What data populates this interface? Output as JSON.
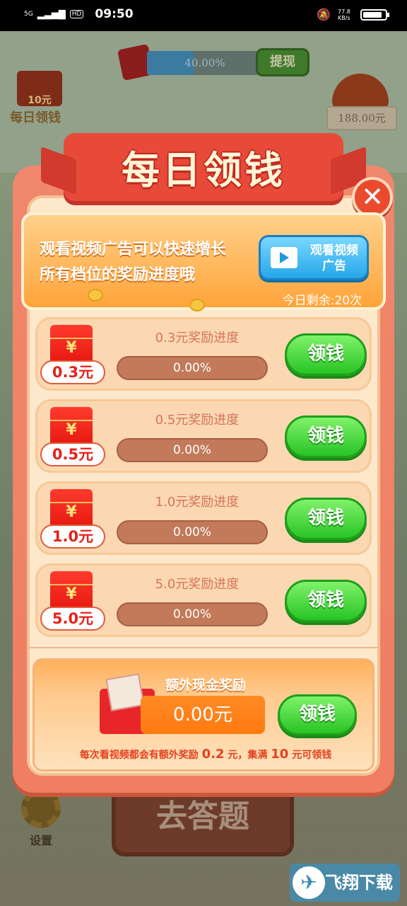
{
  "status_bar": {
    "network": "5G",
    "hd": "HD",
    "time": "09:50",
    "speed": "77.8 KB/s"
  },
  "background": {
    "progress_text": "40.00%",
    "progress_fraction": 0.4,
    "withdraw_label": "提现",
    "daily_icon_amount": "10元",
    "daily_icon_label": "每日领钱",
    "balance": "188.00元",
    "settings_label": "设置",
    "quiz_button": "去答题",
    "watermark_text": "飞翔下载"
  },
  "modal": {
    "title": "每日领钱",
    "close_symbol": "✕",
    "ad": {
      "line1": "观看视频广告可以快速增长",
      "line2": "所有档位的奖励进度哦",
      "watch_button": "观看视频广告",
      "remaining": "今日剩余:20次"
    },
    "tiers": [
      {
        "amount": "0.3元",
        "title": "0.3元奖励进度",
        "progress_text": "0.00%",
        "progress": 0,
        "button": "领钱",
        "yen": "¥"
      },
      {
        "amount": "0.5元",
        "title": "0.5元奖励进度",
        "progress_text": "0.00%",
        "progress": 0,
        "button": "领钱",
        "yen": "¥"
      },
      {
        "amount": "1.0元",
        "title": "1.0元奖励进度",
        "progress_text": "0.00%",
        "progress": 0,
        "button": "领钱",
        "yen": "¥"
      },
      {
        "amount": "5.0元",
        "title": "5.0元奖励进度",
        "progress_text": "0.00%",
        "progress": 0,
        "button": "领钱",
        "yen": "¥"
      }
    ],
    "bonus": {
      "title": "额外现金奖励",
      "amount": "0.00元",
      "button": "领钱",
      "note_prefix": "每次看视频都会有额外奖励",
      "note_value1": "0.2",
      "note_mid": "元，集满",
      "note_value2": "10",
      "note_suffix": "元可领钱"
    }
  },
  "colors": {
    "modal_frame": "#ef7e62",
    "panel_bg": "#fde8cc",
    "green_button": "#28c424",
    "red_text": "#e5221a",
    "blue_button": "#25a7e8"
  }
}
